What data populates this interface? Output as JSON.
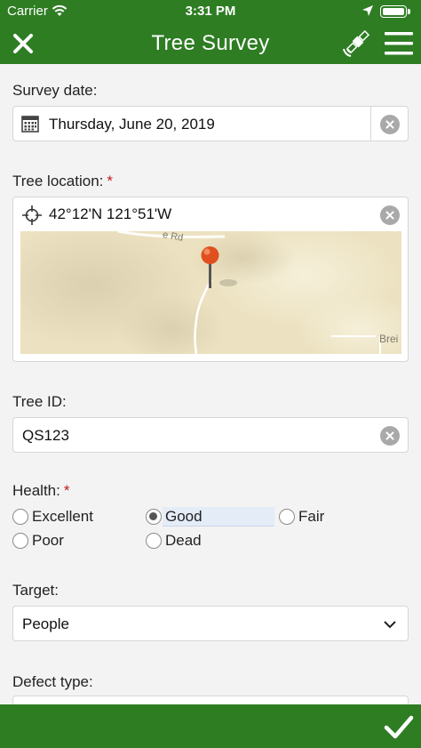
{
  "status": {
    "carrier": "Carrier",
    "time": "3:31 PM"
  },
  "header": {
    "title": "Tree Survey"
  },
  "survey_date": {
    "label": "Survey date:",
    "value": "Thursday, June 20, 2019"
  },
  "tree_location": {
    "label": "Tree location:",
    "required_mark": "*",
    "coords": "42°12'N 121°51'W",
    "map_road_label": "e Rd",
    "map_place_label": "Brei"
  },
  "tree_id": {
    "label": "Tree ID:",
    "value": "QS123"
  },
  "health": {
    "label": "Health:",
    "required_mark": "*",
    "options": [
      {
        "label": "Excellent",
        "checked": false
      },
      {
        "label": "Good",
        "checked": true
      },
      {
        "label": "Fair",
        "checked": false
      },
      {
        "label": "Poor",
        "checked": false
      },
      {
        "label": "Dead",
        "checked": false
      }
    ]
  },
  "target": {
    "label": "Target:",
    "value": "People"
  },
  "defect_type": {
    "label": "Defect type:"
  },
  "colors": {
    "primary": "#2e7d23",
    "background": "#f3f3f3",
    "required": "#c21a1a"
  }
}
